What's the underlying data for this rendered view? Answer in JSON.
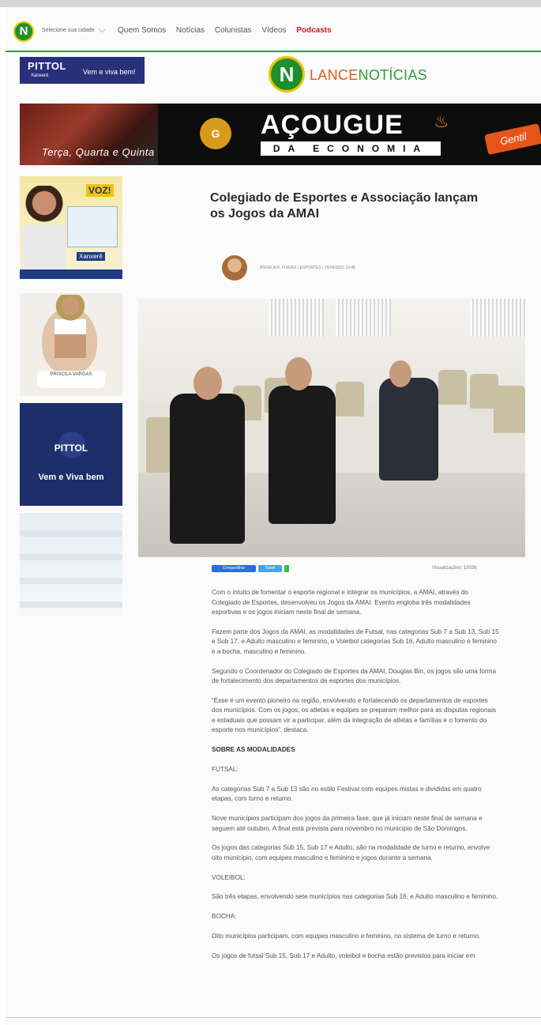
{
  "nav": {
    "logo_letter": "N",
    "city_select": "Selecione sua cidade",
    "links": [
      "Quem Somos",
      "Notícias",
      "Colunistas",
      "Vídeos",
      "Podcasts"
    ]
  },
  "ads": {
    "pittol_top": {
      "brand": "PITTOL",
      "sub": "Xanxerê",
      "slogan": "Vem e viva bem!"
    },
    "banner": {
      "days": "Terça, Quarta e Quinta",
      "title": "AÇOUGUE",
      "subtitle": "DA ECONOMIA",
      "store": "Gentil",
      "logo": "G"
    },
    "side1": {
      "headline": "VOZ!",
      "city": "Xanxerê"
    },
    "side2": {
      "name": "PRISCILA VARGAS"
    },
    "side3": {
      "brand": "PITTOL",
      "slogan": "Vem e Viva bem"
    }
  },
  "brand": {
    "logo_letter": "N",
    "name_part1": "LANCE",
    "name_part2": "NOTÍCIAS"
  },
  "article": {
    "title": "Colegiado de Esportes e Associação lançam os Jogos da AMAI",
    "byline": "ÂNGELA R. FURADI / ESPORTES / 20/04/2023 16:48",
    "share_facebook": "Compartilhar",
    "share_twitter": "Tweet",
    "views": "Visualizações: 15036",
    "paragraphs": [
      "Com o intuito de fomentar o esporte regional e integrar os municípios, a AMAI, através do Colegiado de Esportes, desenvolveu os Jogos da AMAI. Evento engloba três modalidades esportivas e os jogos iniciam neste final de semana.",
      "Fazem parte dos Jogos da AMAI, as modalidades de Futsal, nas categorias Sub 7 a Sub 13, Sub 15 e Sub 17, e Adulto masculino e feminino, o Voleibol categorias Sub 16, Adulto masculino e feminino e a bocha, masculino e feminino.",
      "Segundo o Coordenador do Colegiado de Esportes da AMAI, Douglas Bin, os jogos são uma forma de fortalecimento dos departamentos de esportes dos municípios.",
      "“Esse é um evento pioneiro na região, envolvendo e fortalecendo os departamentos de esportes dos municípios. Com os jogos, os atletas e equipes se preparam melhor para as disputas regionais e estaduais que possam vir a participar, além da integração de atletas e famílias e o fomento do esporte nos municípios”, destaca.",
      "SOBRE AS MODALIDADES",
      "FUTSAL:",
      "As categorias Sub 7 a Sub 13 são no estilo Festival com equipes mistas e divididas em quatro etapas, com turno e returno.",
      "Nove municípios participam dos jogos da primeira fase, que já iniciam neste final de semana e seguem até outubro. A final está prevista para novembro no município de São Domingos.",
      "Os jogos das categorias Sub 15, Sub 17 e Adulto, são na modalidade de turno e returno, envolve oito município, com equipes masculino e feminino e jogos durante a semana.",
      "VOLEIBOL:",
      "São três etapas, envolvendo sete municípios nas categorias Sub 16, e Adulto masculino e feminino.",
      "BOCHA:",
      "Oito municípios participam, com equipes masculino e feminino, no sistema de turno e returno.",
      "Os jogos de futsal Sub 15, Sub 17 e Adulto, voleibol e bocha estão previstos para iniciar em"
    ]
  }
}
